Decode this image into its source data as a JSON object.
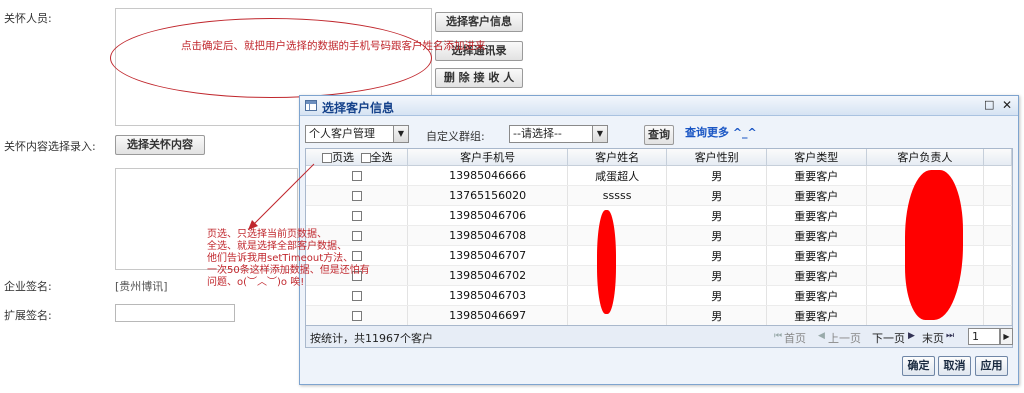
{
  "form": {
    "care_person_label": "关怀人员:",
    "care_content_label": "关怀内容选择录入:",
    "enterprise_sign_label": "企业签名:",
    "enterprise_sign_value": "[贵州博讯]",
    "extended_sign_label": "扩展签名:",
    "select_customer_button": "选择客户信息",
    "select_address_book_button": "选择通讯录",
    "delete_recipient_button": "删 除 接 收 人",
    "select_care_content_button": "选择关怀内容"
  },
  "dialog": {
    "title": "选择客户信息",
    "maximize_icon": "□",
    "close_icon": "✕",
    "customer_type_select": "个人客户管理",
    "custom_group_label": "自定义群组:",
    "group_select": "--请选择--",
    "query_button": "查询",
    "query_more_link": "查询更多 ^_^",
    "columns": {
      "page_select": "页选",
      "select_all": "全选",
      "phone": "客户手机号",
      "name": "客户姓名",
      "gender": "客户性别",
      "type": "客户类型",
      "owner": "客户负责人"
    },
    "rows": [
      {
        "phone": "13985046666",
        "name": "咸蛋超人",
        "gender": "男",
        "type": "重要客户",
        "owner": ""
      },
      {
        "phone": "13765156020",
        "name": "sssss",
        "gender": "男",
        "type": "重要客户",
        "owner": ""
      },
      {
        "phone": "13985046706",
        "name": "",
        "gender": "男",
        "type": "重要客户",
        "owner": ""
      },
      {
        "phone": "13985046708",
        "name": "",
        "gender": "男",
        "type": "重要客户",
        "owner": ""
      },
      {
        "phone": "13985046707",
        "name": "",
        "gender": "男",
        "type": "重要客户",
        "owner": ""
      },
      {
        "phone": "13985046702",
        "name": "",
        "gender": "男",
        "type": "重要客户",
        "owner": ""
      },
      {
        "phone": "13985046703",
        "name": "",
        "gender": "男",
        "type": "重要客户",
        "owner": ""
      },
      {
        "phone": "13985046697",
        "name": "",
        "gender": "男",
        "type": "重要客户",
        "owner": ""
      }
    ],
    "pager": {
      "summary": "按统计，共11967个客户",
      "first": "首页",
      "prev": "上一页",
      "next": "下一页",
      "last": "末页",
      "page": "1"
    },
    "confirm_button": "确定",
    "cancel_button": "取消",
    "apply_button": "应用"
  },
  "annotations": {
    "top_note": "点击确定后、就把用户选择的数据的手机号码跟客户姓名添加进来",
    "side_note_lines": [
      "页选、只选择当前页数据、",
      "全选、就是选择全部客户数据、",
      "他们告诉我用setTimeout方法、",
      "一次50条这样添加数据、但是还怕有",
      "问题、o(︶︿︶)o 唉!"
    ]
  },
  "colors": {
    "annotation": "#c0272d",
    "redaction": "#ff0000",
    "dialog_title_text": "#15428b",
    "link": "#1a56c4"
  }
}
